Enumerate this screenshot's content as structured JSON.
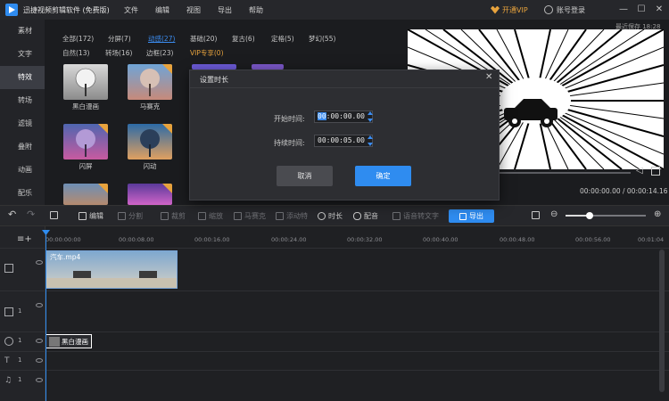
{
  "app": {
    "title": "迅捷视频剪辑软件 (免费版)"
  },
  "menu": {
    "items": [
      "文件",
      "编辑",
      "视图",
      "导出",
      "帮助"
    ]
  },
  "account": {
    "vip_label": "开通VIP",
    "login_label": "账号登录"
  },
  "window_controls": {
    "minimize": "—",
    "maximize": "☐",
    "close": "✕"
  },
  "autosave": "最近保存 18:28",
  "sidebar": {
    "items": [
      {
        "label": "素材"
      },
      {
        "label": "文字"
      },
      {
        "label": "特效"
      },
      {
        "label": "转场"
      },
      {
        "label": "滤镜"
      },
      {
        "label": "叠附"
      },
      {
        "label": "动画"
      },
      {
        "label": "配乐"
      }
    ],
    "active_index": 2
  },
  "library": {
    "categories": [
      {
        "label": "全部(172)"
      },
      {
        "label": "分屏(7)"
      },
      {
        "label": "动感(27)"
      },
      {
        "label": "基础(20)"
      },
      {
        "label": "复古(6)"
      },
      {
        "label": "定格(5)"
      },
      {
        "label": "梦幻(55)"
      },
      {
        "label": "自然(13)"
      },
      {
        "label": "转场(16)"
      },
      {
        "label": "边框(23)"
      },
      {
        "label": "VIP专享(0)"
      }
    ],
    "effects": [
      {
        "label": "黑白漫画",
        "download": false
      },
      {
        "label": "马赛克",
        "download": true
      },
      {
        "label": "闪屏",
        "download": true
      },
      {
        "label": "闪动",
        "download": true
      }
    ]
  },
  "preview": {
    "current_time": "00:00:00.00",
    "total_time": "00:00:14.16",
    "time_display": "00:00:00.00 / 00:00:14.16"
  },
  "toolbar": {
    "edit": "编辑",
    "split": "分割",
    "crop": "裁剪",
    "mosaic_label": "马赛克",
    "zoom_label": "缩放",
    "motion_label": "添动特",
    "duration": "时长",
    "voice": "配音",
    "speech_to_text": "语音转文字",
    "export": "导出"
  },
  "timeline": {
    "ruler": [
      "00:00:00:00",
      "00:00:08.00",
      "00:00:16.00",
      "00:00:24.00",
      "00:00:32.00",
      "00:00:40.00",
      "00:00:48.00",
      "00:00:56.00",
      "00:01:04"
    ],
    "video_clip": "汽车.mp4",
    "effect_clip": "黑白漫画",
    "track_numbers": [
      "1",
      "1",
      "1",
      "1"
    ]
  },
  "dialog": {
    "title": "设置时长",
    "close": "✕",
    "start_label": "开始时间:",
    "start_hours": "00",
    "start_rest": ":00:00.00",
    "duration_label": "持续时间:",
    "duration_value": "00:00:05.00",
    "cancel": "取消",
    "confirm": "确定"
  }
}
